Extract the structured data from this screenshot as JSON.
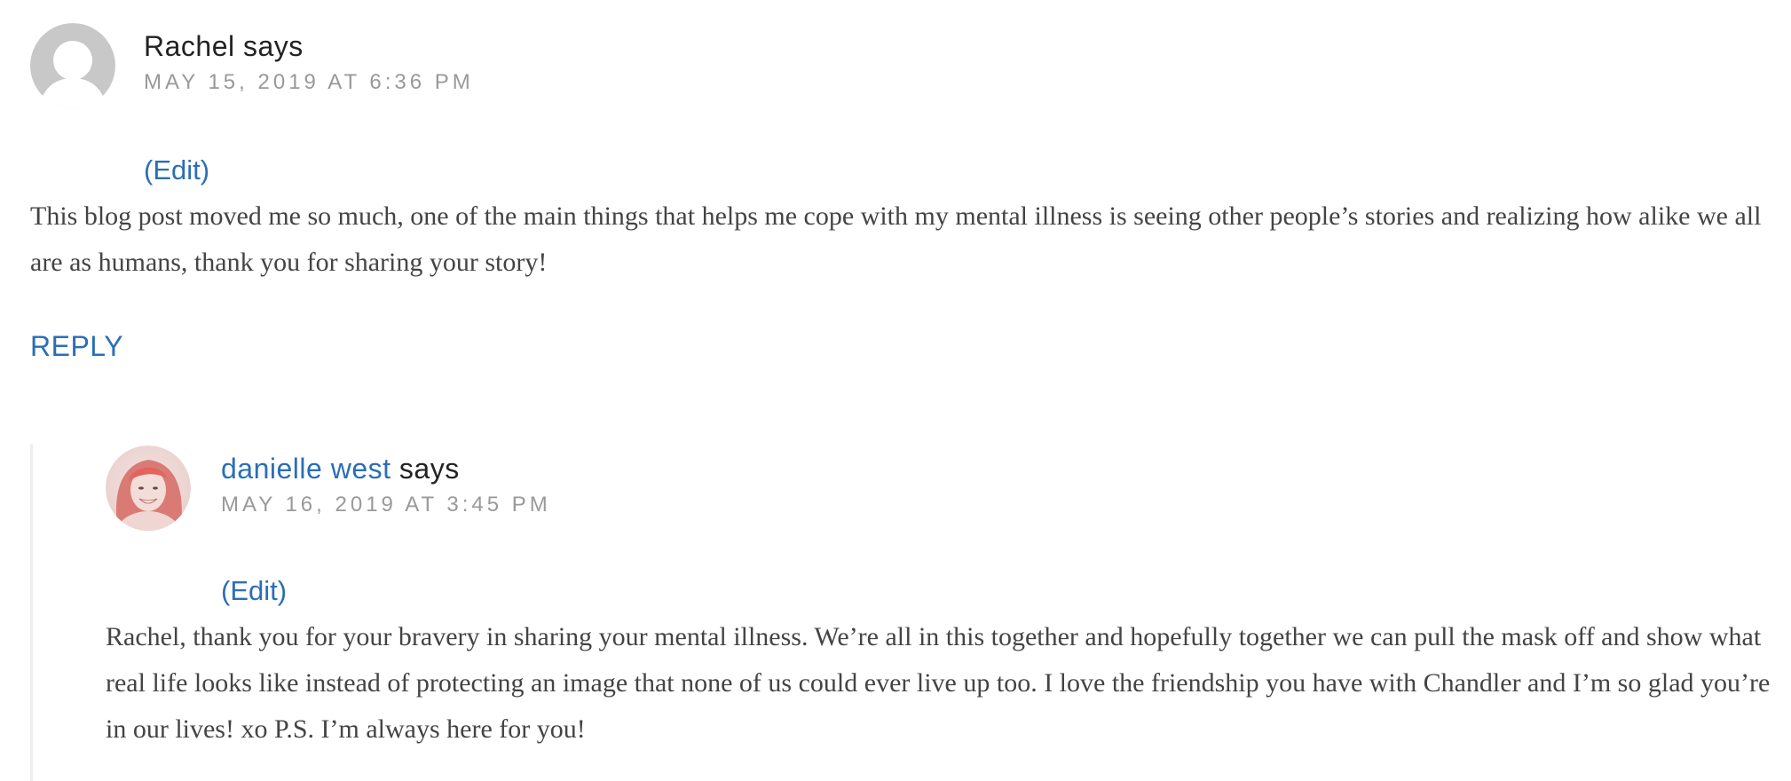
{
  "comments": [
    {
      "author": "Rachel",
      "says": "says",
      "date": "MAY 15, 2019 AT 6:36 PM",
      "edit_label": "(Edit)",
      "text": "This blog post moved me so much, one of the main things that helps me cope with my mental illness is seeing other people’s stories and realizing how alike we all are as humans, thank you for sharing your story!",
      "reply_label": "REPLY",
      "avatar_icon": "default-user-avatar-icon"
    },
    {
      "author": "danielle west",
      "says": "says",
      "date": "MAY 16, 2019 AT 3:45 PM",
      "edit_label": "(Edit)",
      "text": "Rachel, thank you for your bravery in sharing your mental illness. We’re all in this together and hopefully together we can pull the mask off and show what real life looks like instead of protecting an image that none of us could ever live up too. I love the friendship you have with Chandler and I’m so glad you’re in our lives! xo P.S. I’m always here for you!",
      "avatar_icon": "profile-photo-avatar"
    }
  ],
  "colors": {
    "link": "#2b6eb5",
    "text": "#444444",
    "author": "#222222",
    "date": "#999999",
    "avatar_placeholder": "#c8c8c8",
    "thread_border": "#eeeeee"
  }
}
